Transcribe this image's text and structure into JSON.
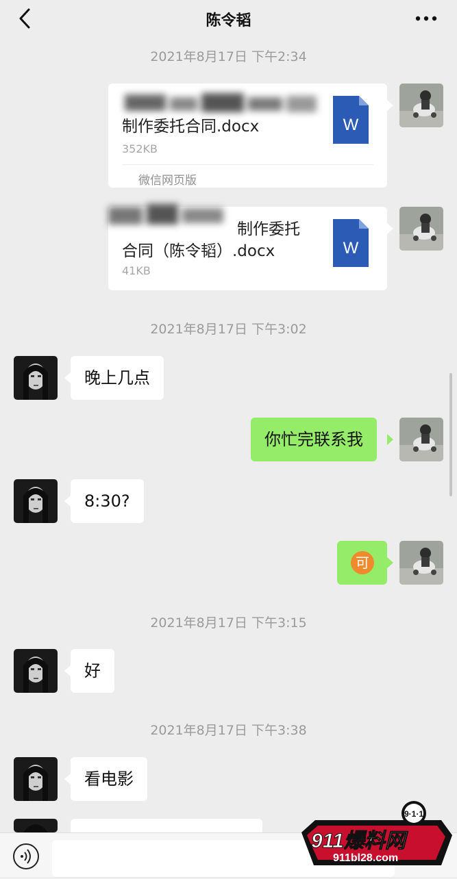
{
  "header": {
    "title": "陈令韬"
  },
  "timestamps": [
    "2021年8月17日 下午2:34",
    "2021年8月17日 下午3:02",
    "2021年8月17日 下午3:15",
    "2021年8月17日 下午3:38"
  ],
  "files": [
    {
      "name_line2": "制作委托合同.docx",
      "size": "352KB",
      "source": "微信网页版",
      "icon_letter": "W"
    },
    {
      "name_line1": "制作委托",
      "name_line2": "合同（陈令韬）.docx",
      "size": "41KB",
      "icon_letter": "W"
    }
  ],
  "messages": [
    {
      "side": "left",
      "text": "晚上几点"
    },
    {
      "side": "right",
      "text": "你忙完联系我"
    },
    {
      "side": "left",
      "text": "8:30?"
    },
    {
      "side": "right",
      "emoji_char": "可"
    },
    {
      "side": "left",
      "text": "好"
    },
    {
      "side": "left",
      "text": "看电影"
    }
  ],
  "watermark": {
    "badge": "9·1·1",
    "brand": "911爆料网",
    "url": "911bl28.com"
  },
  "colors": {
    "background": "#ededed",
    "bubble_self": "#95ec69",
    "bubble_other": "#ffffff",
    "word_icon": "#2b5bb5",
    "timestamp": "#9a9a9a"
  }
}
